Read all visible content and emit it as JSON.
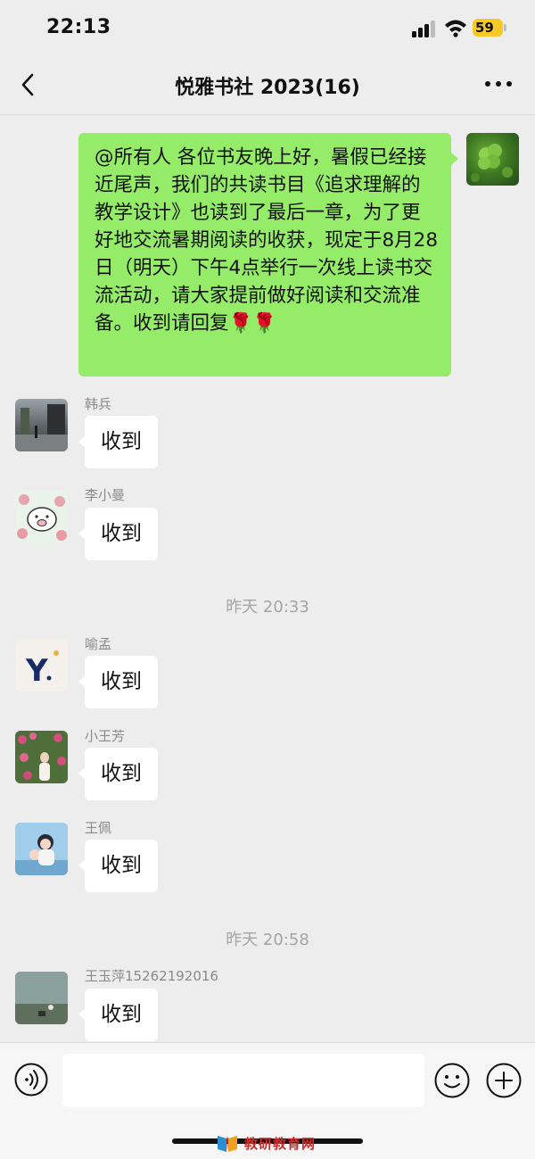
{
  "status_bar": {
    "time": "22:13",
    "battery": "59"
  },
  "nav": {
    "title": "悦雅书社 2023(16)"
  },
  "messages": {
    "self": {
      "text": "@所有人 各位书友晚上好，暑假已经接近尾声，我们的共读书目《追求理解的教学设计》也读到了最后一章，为了更好地交流暑期阅读的收获，现定于8月28日（明天）下午4点举行一次线上读书交流活动，请大家提前做好阅读和交流准备。收到请回复🌹🌹"
    },
    "m1": {
      "sender": "韩兵",
      "text": "收到"
    },
    "m2": {
      "sender": "李小曼",
      "text": "收到"
    },
    "sep1": "昨天 20:33",
    "m3": {
      "sender": "喻孟",
      "text": "收到"
    },
    "m4": {
      "sender": "小王芳",
      "text": "收到"
    },
    "m5": {
      "sender": "王佩",
      "text": "收到"
    },
    "sep2": "昨天 20:58",
    "m6": {
      "sender": "王玉萍15262192016",
      "text": "收到"
    }
  },
  "watermark": {
    "text": "教研教育网"
  },
  "colors": {
    "self_bubble": "#95ec69",
    "background": "#ededed",
    "battery": "#f7c927"
  }
}
